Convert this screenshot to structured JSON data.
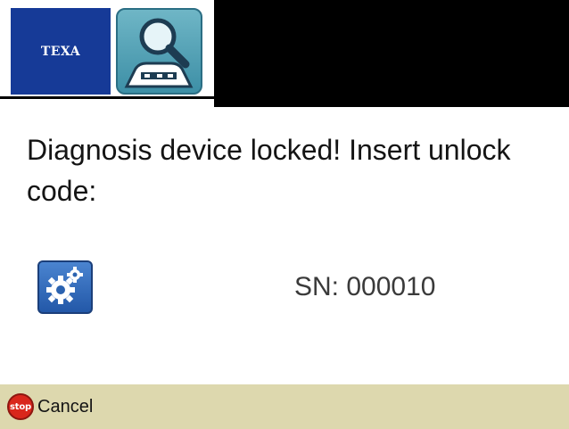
{
  "header": {
    "brand_logo_text": "TEXA",
    "app_icon": "magnifier-vehicle-icon"
  },
  "main": {
    "message": "Diagnosis device locked! Insert unlock code:",
    "settings_icon": "gears-icon",
    "serial_number": "SN: 000010"
  },
  "footer": {
    "stop_icon_text": "stop",
    "cancel_label": "Cancel"
  },
  "colors": {
    "brand_blue": "#163a97",
    "footer_bg": "#ddd8ae",
    "stop_red": "#d9261c"
  }
}
